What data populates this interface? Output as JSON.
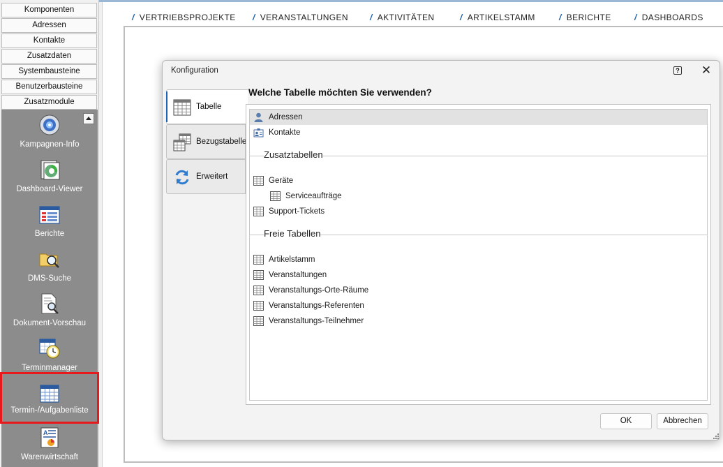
{
  "sidebar": {
    "nav_buttons": [
      "Komponenten",
      "Adressen",
      "Kontakte",
      "Zusatzdaten",
      "Systembausteine",
      "Benutzerbausteine",
      "Zusatzmodule"
    ],
    "modules": [
      {
        "label": "Kampagnen-Info",
        "icon": "globe-disc-icon"
      },
      {
        "label": "Dashboard-Viewer",
        "icon": "dashboard-chart-icon"
      },
      {
        "label": "Berichte",
        "icon": "report-table-icon"
      },
      {
        "label": "DMS-Suche",
        "icon": "folder-search-icon"
      },
      {
        "label": "Dokument-Vorschau",
        "icon": "document-magnifier-icon"
      },
      {
        "label": "Terminmanager",
        "icon": "calendar-clock-icon"
      },
      {
        "label": "Termin-/Aufgabenliste",
        "icon": "calendar-grid-icon",
        "highlighted": true
      },
      {
        "label": "Warenwirtschaft",
        "icon": "inventory-chart-icon"
      }
    ]
  },
  "top_tabs": [
    "VERTRIEBSPROJEKTE",
    "VERANSTALTUNGEN",
    "AKTIVITÄTEN",
    "ARTIKELSTAMM",
    "BERICHTE",
    "DASHBOARDS"
  ],
  "dialog": {
    "title": "Konfiguration",
    "help_glyph": "?",
    "close_glyph": "✕",
    "tabs": [
      "Tabelle",
      "Bezugstabelle",
      "Erweitert"
    ],
    "active_tab": "Tabelle",
    "question": "Welche Tabelle möchten Sie verwenden?",
    "standard_tables": [
      {
        "label": "Adressen",
        "icon": "person-icon",
        "selected": true
      },
      {
        "label": "Kontakte",
        "icon": "contact-card-icon"
      }
    ],
    "zusatz_header": "Zusatztabellen",
    "zusatz_tables": [
      {
        "label": "Geräte",
        "indent": 0
      },
      {
        "label": "Serviceaufträge",
        "indent": 1
      },
      {
        "label": "Support-Tickets",
        "indent": 0
      }
    ],
    "freie_header": "Freie Tabellen",
    "freie_tables": [
      "Artikelstamm",
      "Veranstaltungen",
      "Veranstaltungs-Orte-Räume",
      "Veranstaltungs-Referenten",
      "Veranstaltungs-Teilnehmer"
    ],
    "ok_label": "OK",
    "cancel_label": "Abbrechen"
  },
  "colors": {
    "accent": "#1c63b8",
    "sidebar_panel": "#8c8c8c",
    "highlight_frame": "#e8191c",
    "selected_row": "#e2e2e2"
  }
}
